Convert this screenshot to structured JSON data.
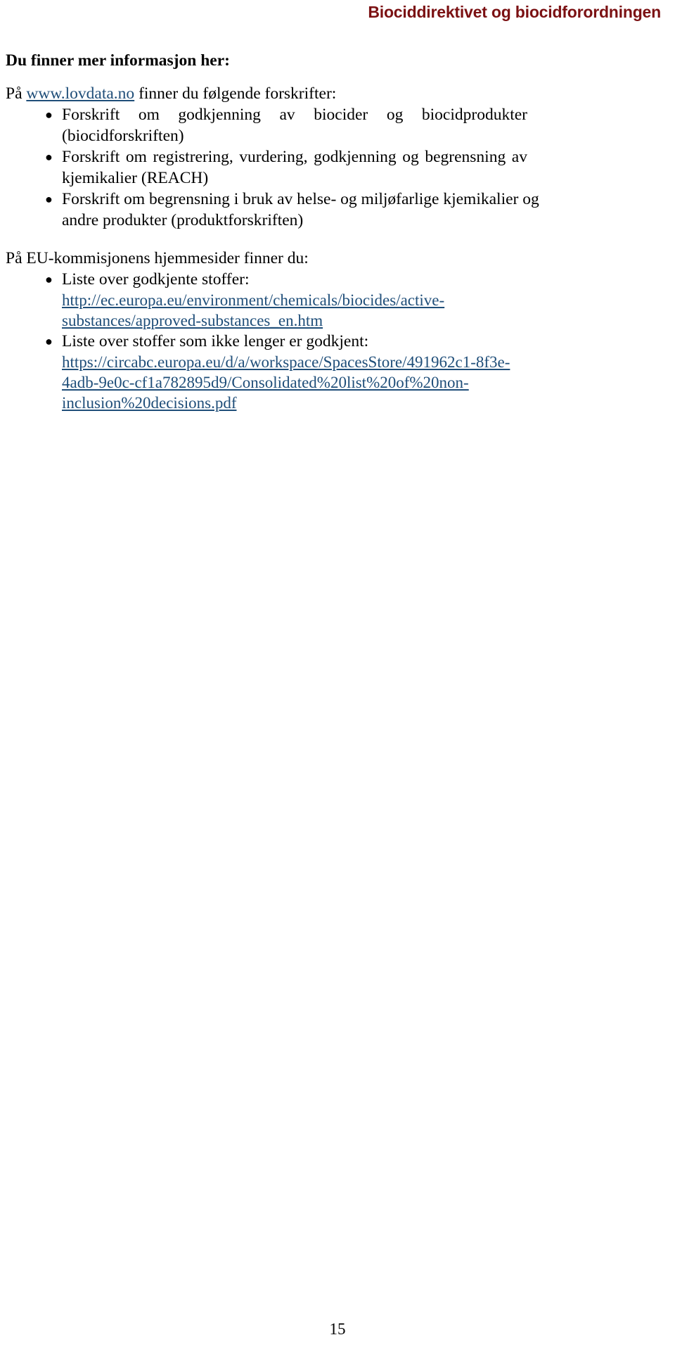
{
  "document": {
    "header_title": "Biociddirektivet og biocidforordningen",
    "header_color": "#7b1113",
    "link_color": "#1f4e79",
    "page_number": "15"
  },
  "sections": {
    "info_heading": "Du finner mer informasjon her:",
    "lovdata": {
      "prefix": "På ",
      "link_text": "www.lovdata.no",
      "suffix": " finner du følgende forskrifter:",
      "items": [
        "Forskrift om godkjenning av biocider og biocidprodukter (biocidforskriften)",
        "Forskrift om registrering, vurdering, godkjenning og begrensning av kjemikalier (REACH)",
        "Forskrift om begrensning i bruk av helse- og miljøfarlige kjemikalier og andre produkter (produktforskriften)"
      ]
    },
    "eu_commission": {
      "lead": "På EU-kommisjonens hjemmesider finner du:",
      "items": [
        {
          "label": "Liste over godkjente stoffer:",
          "url_lines": [
            "http://ec.europa.eu/environment/chemicals/biocides/active-",
            "substances/approved-substances_en.htm"
          ]
        },
        {
          "label": "Liste over stoffer som ikke lenger er godkjent:",
          "url_lines": [
            "https://circabc.europa.eu/d/a/workspace/SpacesStore/491962c1-8f3e-",
            "4adb-9e0c-cf1a782895d9/Consolidated%20list%20of%20non-",
            "inclusion%20decisions.pdf"
          ]
        }
      ]
    }
  }
}
